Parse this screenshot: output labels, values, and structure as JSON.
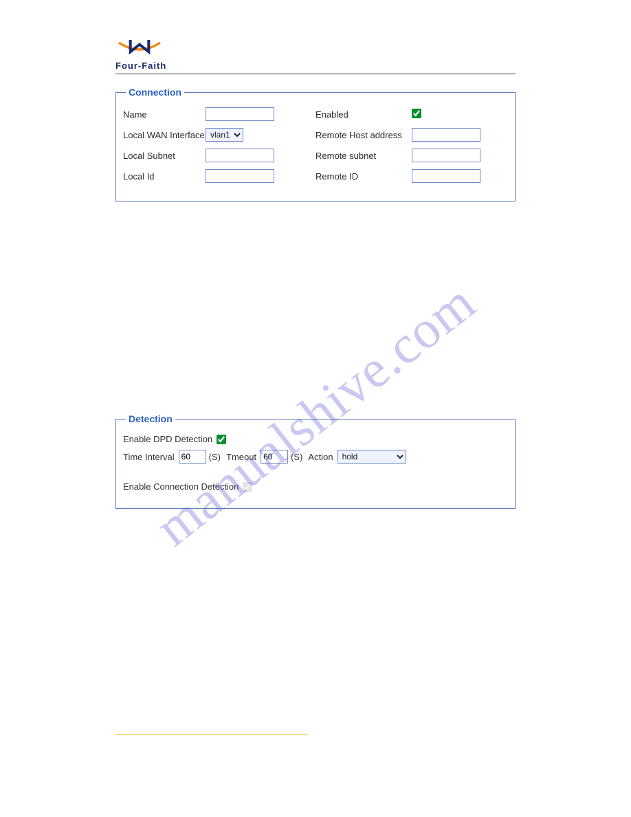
{
  "brand": "Four-Faith",
  "watermark": "manualshive.com",
  "connection": {
    "legend": "Connection",
    "name_label": "Name",
    "name_value": "",
    "enabled_label": "Enabled",
    "enabled_checked": true,
    "wan_label": "Local WAN Interface",
    "wan_value": "vlan1",
    "remote_host_label": "Remote Host address",
    "remote_host_value": "",
    "local_subnet_label": "Local Subnet",
    "local_subnet_value": "",
    "remote_subnet_label": "Remote subnet",
    "remote_subnet_value": "",
    "local_id_label": "Local Id",
    "local_id_value": "",
    "remote_id_label": "Remote ID",
    "remote_id_value": ""
  },
  "detection": {
    "legend": "Detection",
    "dpd_label": "Enable DPD Detection",
    "dpd_checked": true,
    "time_interval_label": "Time Interval",
    "time_interval_value": "60",
    "unit_s": "(S)",
    "tmeout_label": "Tmeout",
    "tmeout_value": "60",
    "action_label": "Action",
    "action_value": "hold",
    "conn_detect_label": "Enable Connection Detection",
    "conn_detect_checked": true
  }
}
